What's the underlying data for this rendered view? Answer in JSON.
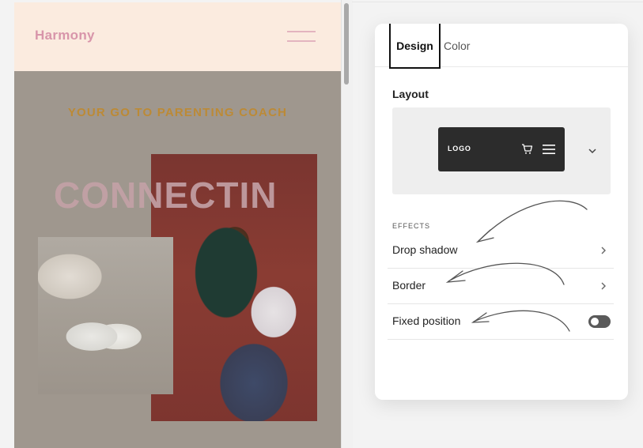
{
  "preview": {
    "brand": "Harmony",
    "tagline": "YOUR GO TO PARENTING COACH",
    "hero_word": "CONNECTIN"
  },
  "panel": {
    "tabs": [
      {
        "label": "Design",
        "active": true
      },
      {
        "label": "Color",
        "active": false
      }
    ],
    "layout_title": "Layout",
    "layout_preview": {
      "logo_text": "LOGO"
    },
    "effects_title": "EFFECTS",
    "effects": [
      {
        "label": "Drop shadow",
        "control": "chevron"
      },
      {
        "label": "Border",
        "control": "chevron"
      },
      {
        "label": "Fixed position",
        "control": "toggle",
        "enabled": false
      }
    ]
  },
  "colors": {
    "brand_pink": "#d895aa",
    "tagline_gold": "#bc8a36",
    "header_cream": "#fbebdf",
    "toggle_dark": "#5a5a5a"
  },
  "icons": [
    "hamburger-icon",
    "cart-icon",
    "menu-icon",
    "chevron-down-icon",
    "chevron-right-icon"
  ]
}
